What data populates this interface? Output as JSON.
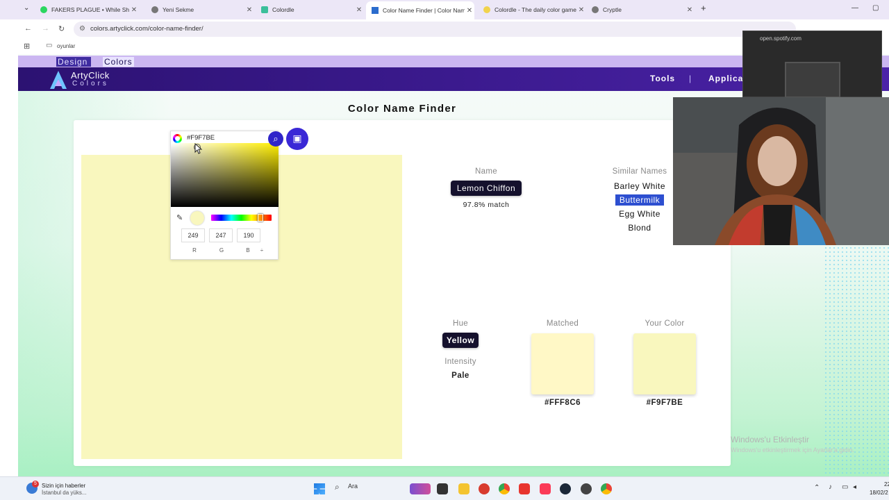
{
  "browser": {
    "tabs": [
      {
        "title": "FAKERS PLAGUE • While Sh",
        "color": "#2bd660"
      },
      {
        "title": "Yeni Sekme",
        "color": "#555555"
      },
      {
        "title": "Colordle",
        "color": "#3bbf9b"
      },
      {
        "title": "Color Name Finder | Color Nam",
        "color": "#2b6ccd"
      },
      {
        "title": "Colordle - The daily color game",
        "color": "#f1d34d"
      },
      {
        "title": "Cryptle",
        "color": "#555555"
      }
    ],
    "url": "colors.artyclick.com/color-name-finder/",
    "bookmark": "oyunlar"
  },
  "site": {
    "top_tab_design": "Design",
    "top_tab_colors": "Colors",
    "logo_line1": "ArtyClick",
    "logo_line2": "Colors",
    "nav_tools": "Tools",
    "nav_applications": "Applicat",
    "nav_separator": "|"
  },
  "page": {
    "title": "Color Name Finder",
    "hex_input": "#F9F7BE",
    "rgb": {
      "r": "249",
      "g": "247",
      "b": "190",
      "r_label": "R",
      "g_label": "G",
      "b_label": "B",
      "toggle": "÷"
    },
    "name_label": "Name",
    "name_value": "Lemon Chiffon",
    "match": "97.8% match",
    "similar_label": "Similar Names",
    "similar": [
      "Barley White",
      "Buttermilk",
      "Egg White",
      "Blond"
    ],
    "hue_label": "Hue",
    "hue_value": "Yellow",
    "intensity_label": "Intensity",
    "intensity_value": "Pale",
    "matched_label": "Matched",
    "matched_hex": "#FFF8C6",
    "your_label": "Your Color",
    "your_hex": "#F9F7BE"
  },
  "overlays": {
    "spotify_title": "open.spotify.com",
    "activate_line1": "Windows'u Etkinleştir",
    "activate_line2": "Windows'u etkinleştirmek için Ayarlar'a gidin."
  },
  "taskbar": {
    "news_title": "Sizin için haberler",
    "news_sub": "İstanbul da yüks...",
    "news_badge": "5",
    "search": "Ara",
    "time": "22",
    "date": "18/02/2"
  },
  "colors": {
    "user_color": "#F9F7BE",
    "matched_color": "#FFF8C6",
    "accent": "#3a28d6"
  }
}
